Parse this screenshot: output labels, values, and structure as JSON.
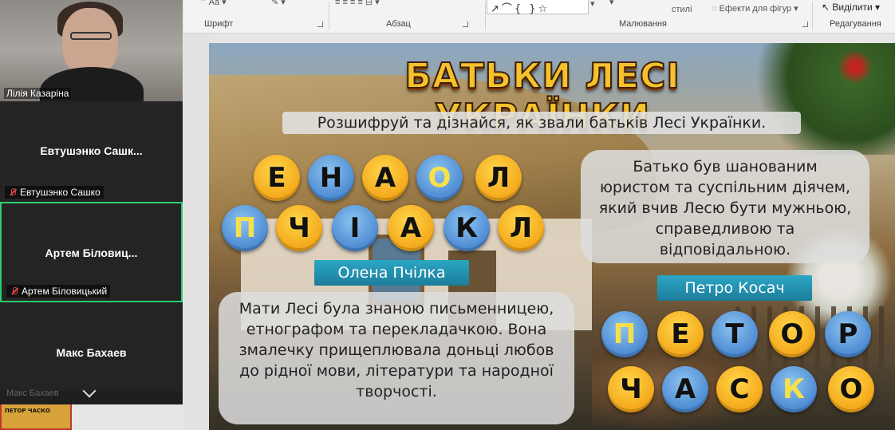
{
  "participants": [
    {
      "name": "Лілія Казаріна",
      "has_video": true
    },
    {
      "display": "Евтушэнко  Сашк...",
      "name": "Евтушэнко Сашко",
      "muted": true
    },
    {
      "display": "Артем Біловиц...",
      "name": "Артем Біловицький",
      "muted": true,
      "active": true
    },
    {
      "display": "Макс Бахаев",
      "name": "Макс Бахаев"
    }
  ],
  "ribbon": {
    "groups": {
      "font": "Шрифт",
      "paragraph": "Абзац",
      "drawing": "Малювання",
      "editing": "Редагування"
    },
    "styles_label": "стилі",
    "shape_effects": "Ефекти для фігур",
    "select": "Виділити",
    "shape_glyphs": "↗⌒{ }☆"
  },
  "thumbnail": {
    "text": "ПЕТОР ЧАСКО"
  },
  "slide": {
    "title": "БАТЬКИ ЛЕСІ УКРАЇНКИ",
    "subtitle": "Розшифруй та дізнайся, як звали батьків Лесі Українки.",
    "row1": [
      {
        "letter": "Е",
        "color": "orange"
      },
      {
        "letter": "Н",
        "color": "blue-dark"
      },
      {
        "letter": "А",
        "color": "orange"
      },
      {
        "letter": "О",
        "color": "blue"
      },
      {
        "letter": "Л",
        "color": "orange"
      }
    ],
    "row2": [
      {
        "letter": "П",
        "color": "blue"
      },
      {
        "letter": "Ч",
        "color": "orange"
      },
      {
        "letter": "І",
        "color": "blue-dark"
      },
      {
        "letter": "А",
        "color": "orange"
      },
      {
        "letter": "К",
        "color": "blue-dark"
      },
      {
        "letter": "Л",
        "color": "orange"
      }
    ],
    "row3": [
      {
        "letter": "П",
        "color": "blue"
      },
      {
        "letter": "Е",
        "color": "orange"
      },
      {
        "letter": "Т",
        "color": "blue-dark"
      },
      {
        "letter": "О",
        "color": "orange"
      },
      {
        "letter": "Р",
        "color": "blue-dark"
      }
    ],
    "row4": [
      {
        "letter": "Ч",
        "color": "orange"
      },
      {
        "letter": "А",
        "color": "blue-dark"
      },
      {
        "letter": "С",
        "color": "orange"
      },
      {
        "letter": "К",
        "color": "blue"
      },
      {
        "letter": "О",
        "color": "orange"
      }
    ],
    "answer_mother": "Олена Пчілка",
    "answer_father": "Петро Косач",
    "father_text": "Батько був шанованим юристом та суспільним діячем, який вчив Лесю бути мужньою, справедливою та відповідальною.",
    "mother_text": "Мати Лесі була знаною письменницею, етнографом та перекладачкою. Вона змалечку прищеплювала доньці любов до рідної мови, літератури та народної творчості."
  }
}
